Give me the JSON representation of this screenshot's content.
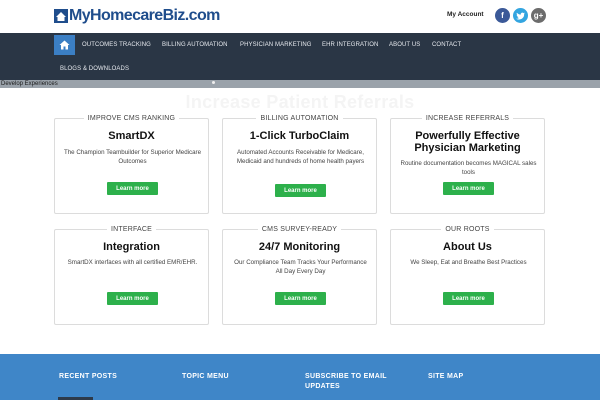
{
  "header": {
    "logo_text": "MyHomecareBiz.com",
    "account_label": "My Account",
    "social": [
      "facebook-icon",
      "twitter-icon",
      "google-plus-icon"
    ]
  },
  "nav": {
    "items": [
      "OUTCOMES TRACKING",
      "BILLING AUTOMATION",
      "PHYSICIAN MARKETING",
      "EHR INTEGRATION",
      "ABOUT US",
      "CONTACT",
      "BLOGS & DOWNLOADS"
    ]
  },
  "strip": {
    "label": "Develop Experiences"
  },
  "hero": {
    "title": "Increase Patient Referrals"
  },
  "cards": [
    {
      "category": "IMPROVE CMS RANKING",
      "title": "SmartDX",
      "desc": "The Champion Teambuilder for Superior Medicare Outcomes",
      "button": "Learn more"
    },
    {
      "category": "BILLING AUTOMATION",
      "title": "1-Click TurboClaim",
      "desc": "Automated Accounts Receivable for Medicare, Medicaid and hundreds of home health payers",
      "button": "Learn more"
    },
    {
      "category": "INCREASE REFERRALS",
      "title": "Powerfully Effective Physician Marketing",
      "desc": "Routine documentation becomes MAGICAL sales tools",
      "button": "Learn more"
    },
    {
      "category": "INTERFACE",
      "title": "Integration",
      "desc": "SmartDX interfaces with all certified EMR/EHR.",
      "button": "Learn more"
    },
    {
      "category": "CMS SURVEY-READY",
      "title": "24/7 Monitoring",
      "desc": "Our Compliance Team Tracks Your Performance All Day Every Day",
      "button": "Learn more"
    },
    {
      "category": "OUR ROOTS",
      "title": "About Us",
      "desc": "We Sleep, Eat and Breathe Best Practices",
      "button": "Learn more"
    }
  ],
  "footer": {
    "headings": [
      "RECENT POSTS",
      "TOPIC MENU",
      "SUBSCRIBE TO EMAIL UPDATES",
      "SITE MAP"
    ]
  },
  "colors": {
    "nav_bg": "#2a3645",
    "home_active": "#3b7fc4",
    "button_green": "#2db04b",
    "footer_blue": "#3f86c8"
  }
}
